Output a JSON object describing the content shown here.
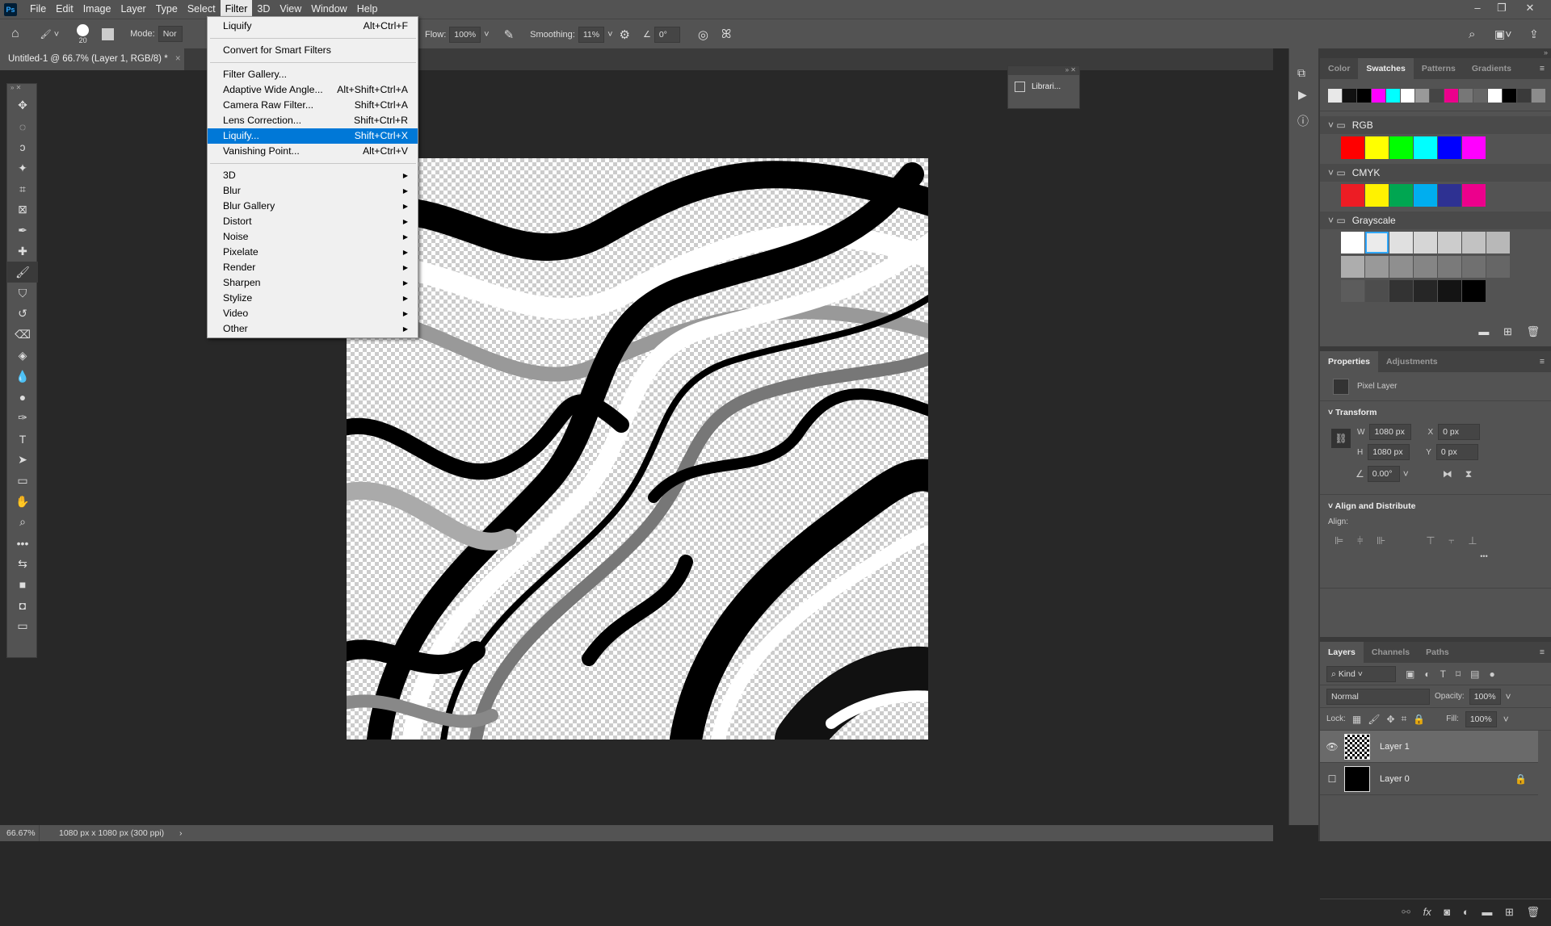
{
  "app": {
    "logo": "Ps"
  },
  "menubar": [
    "File",
    "Edit",
    "Image",
    "Layer",
    "Type",
    "Select",
    "Filter",
    "3D",
    "View",
    "Window",
    "Help"
  ],
  "options": {
    "brush_size": "20",
    "mode_label": "Mode:",
    "mode_value": "Nor",
    "flow_label": "Flow:",
    "flow_value": "100%",
    "smoothing_label": "Smoothing:",
    "smoothing_value": "11%",
    "angle_value": "0°"
  },
  "document_tab": {
    "title": "Untitled-1 @ 66.7% (Layer 1, RGB/8) *",
    "close": "×"
  },
  "filter_menu": {
    "top": [
      {
        "label": "Liquify",
        "shortcut": "Alt+Ctrl+F"
      }
    ],
    "smart": [
      {
        "label": "Convert for Smart Filters",
        "shortcut": ""
      }
    ],
    "filters": [
      {
        "label": "Filter Gallery...",
        "shortcut": ""
      },
      {
        "label": "Adaptive Wide Angle...",
        "shortcut": "Alt+Shift+Ctrl+A"
      },
      {
        "label": "Camera Raw Filter...",
        "shortcut": "Shift+Ctrl+A"
      },
      {
        "label": "Lens Correction...",
        "shortcut": "Shift+Ctrl+R"
      },
      {
        "label": "Liquify...",
        "shortcut": "Shift+Ctrl+X",
        "highlighted": true
      },
      {
        "label": "Vanishing Point...",
        "shortcut": "Alt+Ctrl+V"
      }
    ],
    "submenus": [
      "3D",
      "Blur",
      "Blur Gallery",
      "Distort",
      "Noise",
      "Pixelate",
      "Render",
      "Sharpen",
      "Stylize",
      "Video",
      "Other"
    ],
    "highlight_color": "#0078d7"
  },
  "libraries": {
    "label": "Librari..."
  },
  "swatches_panel": {
    "tabs": [
      "Color",
      "Swatches",
      "Patterns",
      "Gradients"
    ],
    "active": "Swatches",
    "recent": [
      "#e8e8e8",
      "#111111",
      "#000000",
      "#ff00ff",
      "#00ffff",
      "#ffffff",
      "#999999",
      "#454545",
      "#ec008c",
      "#777777",
      "#666666",
      "#ffffff",
      "#000000",
      "#3a3a3a",
      "#8c8c8c"
    ],
    "groups": [
      {
        "name": "RGB",
        "colors": [
          "#ff0000",
          "#ffff00",
          "#00ff00",
          "#00ffff",
          "#0000ff",
          "#ff00ff"
        ]
      },
      {
        "name": "CMYK",
        "colors": [
          "#ed1c24",
          "#fff200",
          "#00a651",
          "#00aeef",
          "#2e3192",
          "#ec008c"
        ]
      },
      {
        "name": "Grayscale",
        "colors": [
          "#ffffff",
          "#ebebeb",
          "#e0e0e0",
          "#d6d6d6",
          "#cccccc",
          "#c2c2c2",
          "#b8b8b8",
          "#adadad",
          "#999999",
          "#8f8f8f",
          "#858585",
          "#7a7a7a",
          "#707070",
          "#666666",
          "#5c5c5c",
          "#4d4d4d",
          "#333333",
          "#262626",
          "#141414",
          "#000000"
        ]
      }
    ]
  },
  "properties_panel": {
    "tabs": [
      "Properties",
      "Adjustments"
    ],
    "active": "Properties",
    "layer_type": "Pixel Layer",
    "transform": {
      "title": "Transform",
      "w_label": "W",
      "w": "1080 px",
      "h_label": "H",
      "h": "1080 px",
      "x_label": "X",
      "x": "0 px",
      "y_label": "Y",
      "y": "0 px",
      "angle": "0.00°"
    },
    "align": {
      "title": "Align and Distribute",
      "label": "Align:",
      "more": "•••"
    }
  },
  "layers_panel": {
    "tabs": [
      "Layers",
      "Channels",
      "Paths"
    ],
    "active": "Layers",
    "filter": "Kind",
    "blend_mode": "Normal",
    "opacity_label": "Opacity:",
    "opacity": "100%",
    "lock_label": "Lock:",
    "fill_label": "Fill:",
    "fill": "100%",
    "layers": [
      {
        "name": "Layer 1",
        "visible": true,
        "selected": true,
        "locked": false
      },
      {
        "name": "Layer 0",
        "visible": false,
        "selected": false,
        "locked": true
      }
    ]
  },
  "status": {
    "zoom": "66.67%",
    "doc_info": "1080 px x 1080 px (300 ppi)",
    "arrow": "›"
  }
}
